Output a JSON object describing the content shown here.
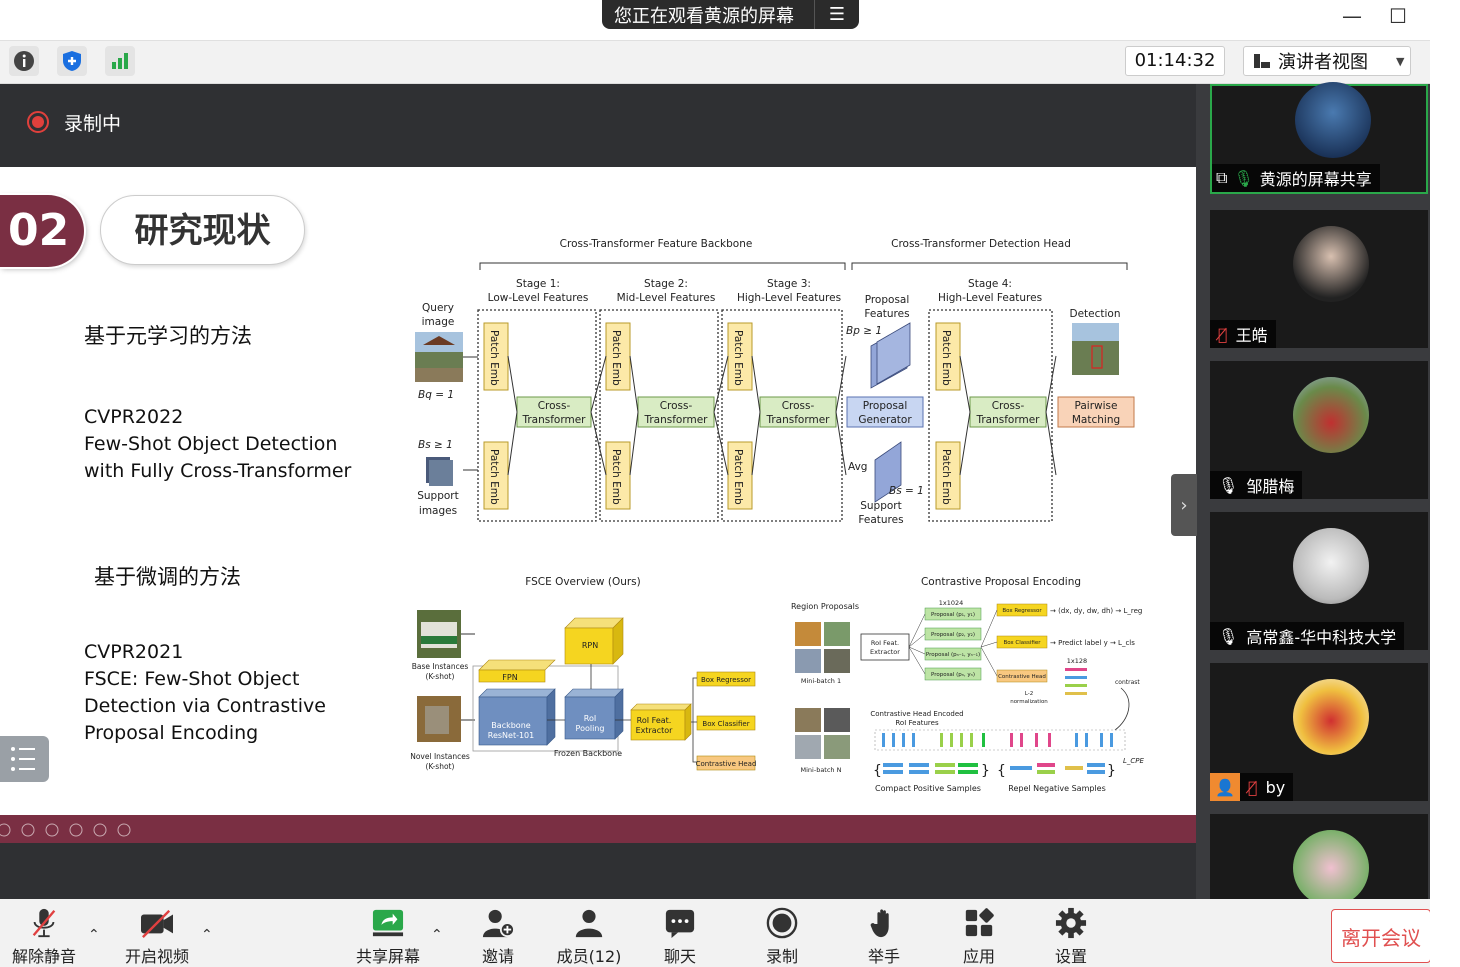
{
  "top": {
    "viewing_label": "您正在观看黄源的屏幕",
    "menu_glyph": "☰",
    "minimize": "—",
    "maximize": "☐"
  },
  "toolbar": {
    "timer": "01:14:32",
    "view_mode": "演讲者视图"
  },
  "recording": {
    "label": "录制中"
  },
  "slide": {
    "number": "02",
    "title": "研究现状",
    "sec1": "基于元学习的方法",
    "ref1": [
      "CVPR2022",
      "Few-Shot Object Detection",
      "with Fully Cross-Transformer"
    ],
    "sec2": "基于微调的方法",
    "ref2": [
      "CVPR2021",
      "FSCE: Few-Shot Object",
      "Detection via Contrastive",
      "Proposal Encoding"
    ],
    "fig1": {
      "backbone_title": "Cross-Transformer Feature Backbone",
      "head_title": "Cross-Transformer Detection Head",
      "stage1": [
        "Stage 1:",
        "Low-Level Features"
      ],
      "stage2": [
        "Stage 2:",
        "Mid-Level Features"
      ],
      "stage3": [
        "Stage 3:",
        "High-Level Features"
      ],
      "stage4": [
        "Stage 4:",
        "High-Level Features"
      ],
      "proposal_features": [
        "Proposal",
        "Features"
      ],
      "query": [
        "Query",
        "image"
      ],
      "bq": "Bq = 1",
      "bs": "Bs ≥ 1",
      "bp": "Bp ≥ 1",
      "bs2": "Bs = 1",
      "support": [
        "Support",
        "images"
      ],
      "support_features": [
        "Support",
        "Features"
      ],
      "patch_emb": "Patch Emb",
      "cross_transformer": [
        "Cross-",
        "Transformer"
      ],
      "proposal_generator": [
        "Proposal",
        "Generator"
      ],
      "avg": "Avg",
      "detection": "Detection",
      "pairwise": [
        "Pairwise",
        "Matching"
      ]
    },
    "fig2": {
      "title": "FSCE Overview (Ours)",
      "base": [
        "Base Instances",
        "(K-shot)"
      ],
      "novel": [
        "Novel Instances",
        "(K-shot)"
      ],
      "rpn": "RPN",
      "fpn": "FPN",
      "backbone": [
        "Backbone",
        "ResNet-101"
      ],
      "roi_pooling": [
        "RoI",
        "Pooling"
      ],
      "frozen": "Frozen Backbone",
      "roi_extractor": [
        "RoI Feat.",
        "Extractor"
      ],
      "box_regressor": "Box Regressor",
      "box_classifier": "Box Classifier",
      "contrastive_head": "Contrastive Head"
    },
    "fig3": {
      "title": "Contrastive Proposal Encoding",
      "region": "Region Proposals",
      "mb1": "Mini-batch 1",
      "mbn": "Mini-batch N",
      "roi_extractor": [
        "RoI Feat.",
        "Extractor"
      ],
      "dim1": "1x1024",
      "proposals": [
        "Proposal (p₁, y₁)",
        "Proposal (p₂, y₂)",
        "Proposal (pₙ₋₁, yₙ₋₁)",
        "Proposal (pₙ, yₙ)"
      ],
      "box_reg": "Box Regressor",
      "box_cls": "Box Classifier",
      "con_head": "Contrastive Head",
      "reg_out": "→ (dx, dy, dw, dh) → L_reg",
      "cls_out": "→ Predict label y → L_cls",
      "dim2": "1x128",
      "l2": [
        "L-2",
        "normalization"
      ],
      "contrast": "contrast",
      "encoded": [
        "Contrastive Head Encoded",
        "RoI Features"
      ],
      "lcpe": "L_CPE",
      "compact": "Compact Positive Samples",
      "repel": "Repel Negative Samples"
    }
  },
  "participants": [
    {
      "name": "黄源的屏幕共享",
      "muted": false,
      "sharing": true
    },
    {
      "name": "王皓",
      "muted": true
    },
    {
      "name": "邹腊梅",
      "muted": false
    },
    {
      "name": "高常鑫-华中科技大学",
      "muted": false
    },
    {
      "name": "by",
      "muted": true
    }
  ],
  "bottom": {
    "unmute": "解除静音",
    "video": "开启视频",
    "share": "共享屏幕",
    "invite": "邀请",
    "members": "成员(12)",
    "chat": "聊天",
    "record": "录制",
    "raise": "举手",
    "apps": "应用",
    "settings": "设置",
    "leave": "离开会议"
  },
  "colors": {
    "accent": "#7a2f43",
    "leave": "#e05050",
    "dark": "#2f3033",
    "record": "#e0403c"
  }
}
